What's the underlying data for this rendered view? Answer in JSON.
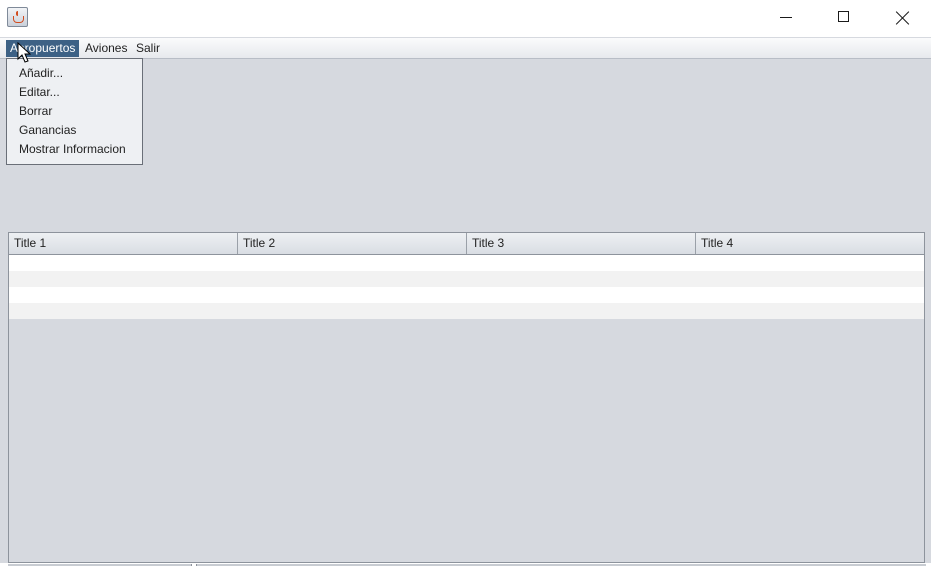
{
  "window": {
    "icon": "java-icon",
    "controls": {
      "minimize_icon": "minimize-icon",
      "maximize_icon": "maximize-icon",
      "close_icon": "close-icon"
    }
  },
  "menubar": {
    "items": [
      {
        "label": "Aeropuertos",
        "active": true
      },
      {
        "label": "Aviones"
      },
      {
        "label": "Salir"
      }
    ]
  },
  "dropdown": {
    "items": [
      {
        "label": "Añadir..."
      },
      {
        "label": "Editar..."
      },
      {
        "label": "Borrar"
      },
      {
        "label": "Ganancias"
      },
      {
        "label": "Mostrar Informacion"
      }
    ]
  },
  "table": {
    "columns": [
      "Title 1",
      "Title 2",
      "Title 3",
      "Title 4"
    ],
    "rows": [
      [
        "",
        "",
        "",
        ""
      ],
      [
        "",
        "",
        "",
        ""
      ],
      [
        "",
        "",
        "",
        ""
      ],
      [
        "",
        "",
        "",
        ""
      ]
    ]
  },
  "colors": {
    "menu_highlight": "#3d6185",
    "background": "#d6d9df"
  }
}
